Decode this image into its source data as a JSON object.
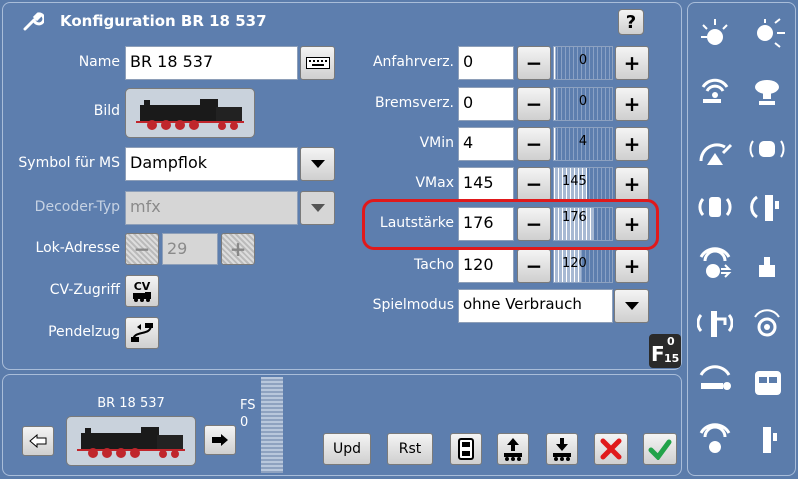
{
  "title": "Konfiguration BR 18 537",
  "help_label": "?",
  "form": {
    "name_label": "Name",
    "name_value": "BR 18 537",
    "bild_label": "Bild",
    "symbol_label": "Symbol für MS",
    "symbol_value": "Dampflok",
    "decoder_label": "Decoder-Typ",
    "decoder_value": "mfx",
    "adresse_label": "Lok-Adresse",
    "adresse_value": "29",
    "cv_label": "CV-Zugriff",
    "cv_button": "CV",
    "pendel_label": "Pendelzug"
  },
  "params": [
    {
      "label": "Anfahrverz.",
      "value": "0",
      "slider": "0",
      "level": 0
    },
    {
      "label": "Bremsverz.",
      "value": "0",
      "slider": "0",
      "level": 0
    },
    {
      "label": "VMin",
      "value": "4",
      "slider": "4",
      "level": 0.016
    },
    {
      "label": "VMax",
      "value": "145",
      "slider": "145",
      "level": 0.57
    },
    {
      "label": "Lautstärke",
      "value": "176",
      "slider": "176",
      "level": 0.69
    },
    {
      "label": "Tacho",
      "value": "120",
      "slider": "120",
      "level": 0.47
    }
  ],
  "spielmodus": {
    "label": "Spielmodus",
    "value": "ohne Verbrauch"
  },
  "f015": {
    "f": "F",
    "top": "0",
    "bottom": "15"
  },
  "bottom": {
    "loco_name": "BR 18 537",
    "fs_label": "FS",
    "fs_value": "0",
    "upd_label": "Upd",
    "rst_label": "Rst"
  },
  "sidebar_icons": [
    "light-icon",
    "cab-light-icon",
    "smoke-icon",
    "whistle-icon",
    "coal-shovel-icon",
    "brake-sound-icon",
    "coupler-sound-icon",
    "door-icon",
    "wind-icon",
    "weight-icon",
    "injector-icon",
    "bell-icon",
    "steam-icon",
    "station-icon",
    "horn-icon",
    "door2-icon"
  ],
  "colors": {
    "background": "#5b7cab",
    "highlight": "#e0191b",
    "accent_green": "#22a34a"
  }
}
